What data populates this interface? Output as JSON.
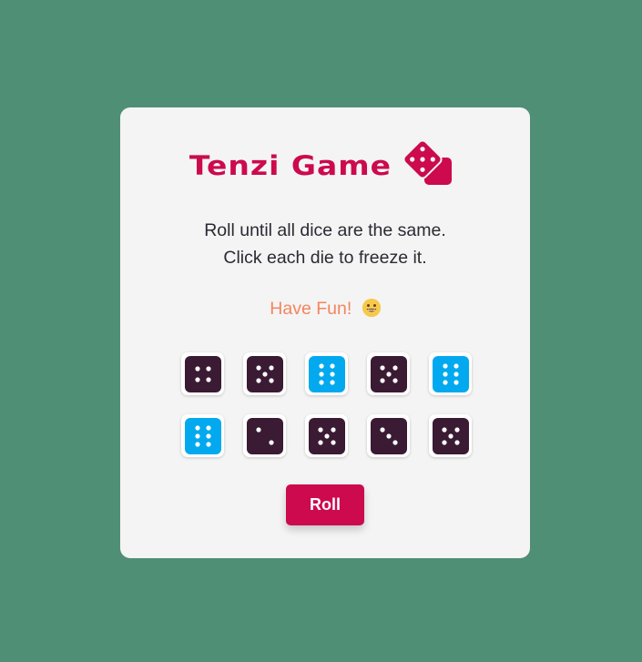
{
  "title": "Tenzi Game",
  "instructions": {
    "line1": "Roll until all dice are the same.",
    "line2": "Click each die to freeze it."
  },
  "fun_text": "Have Fun!",
  "colors": {
    "background": "#4f8f75",
    "card": "#f4f4f4",
    "accent": "#cc0a4d",
    "die_normal": "#3b1a33",
    "die_held": "#03a9ef",
    "fun_text": "#f4845f"
  },
  "dice": [
    {
      "value": 4,
      "held": false
    },
    {
      "value": 5,
      "held": false
    },
    {
      "value": 6,
      "held": true
    },
    {
      "value": 5,
      "held": false
    },
    {
      "value": 6,
      "held": true
    },
    {
      "value": 6,
      "held": true
    },
    {
      "value": 2,
      "held": false
    },
    {
      "value": 5,
      "held": false
    },
    {
      "value": 3,
      "held": false
    },
    {
      "value": 5,
      "held": false
    }
  ],
  "roll_button": "Roll",
  "icons": {
    "logo": "dice-logo-icon",
    "emoji": "grinning-face-icon"
  }
}
